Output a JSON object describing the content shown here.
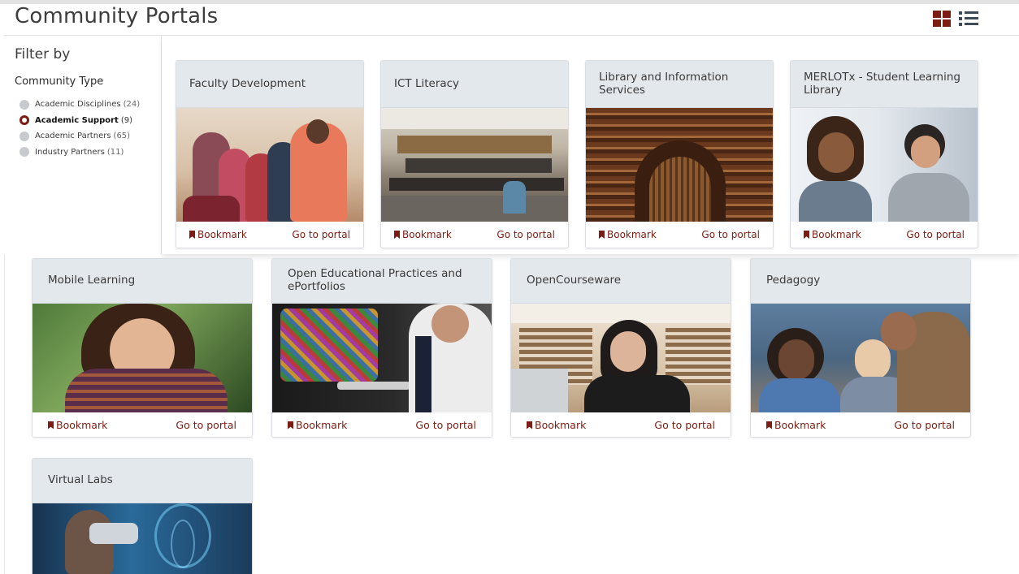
{
  "header": {
    "title": "Community Portals",
    "grid_view_icon": "grid-view-icon",
    "list_view_icon": "list-view-icon"
  },
  "sidebar": {
    "title": "Filter by",
    "section": "Community Type",
    "items": [
      {
        "label": "Academic Disciplines",
        "count": "(24)",
        "selected": false
      },
      {
        "label": "Academic Support",
        "count": "(9)",
        "selected": true
      },
      {
        "label": "Academic Partners",
        "count": "(65)",
        "selected": false
      },
      {
        "label": "Industry Partners",
        "count": "(11)",
        "selected": false
      }
    ]
  },
  "actions": {
    "bookmark": "Bookmark",
    "go": "Go to portal"
  },
  "cards": [
    {
      "title": "Faculty Development"
    },
    {
      "title": "ICT Literacy"
    },
    {
      "title": "Library and Information Services"
    },
    {
      "title": "MERLOTx - Student Learning Library"
    },
    {
      "title": "Mobile Learning"
    },
    {
      "title": "Open Educational Practices and ePortfolios"
    },
    {
      "title": "OpenCourseware"
    },
    {
      "title": "Pedagogy"
    },
    {
      "title": "Virtual Labs"
    }
  ],
  "colors": {
    "accent": "#7b1d12",
    "card_header": "#e3e8ec",
    "radio_off": "#c7cbd0"
  }
}
